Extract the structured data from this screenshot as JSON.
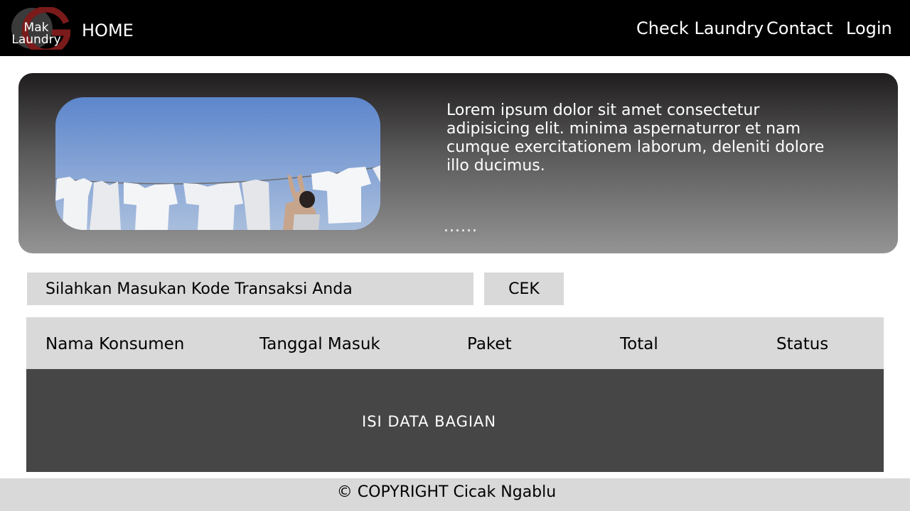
{
  "brand": {
    "logo_line1": "Mak",
    "logo_line2": "Laundry",
    "accent_color": "#7a1a1a"
  },
  "nav": {
    "home": "HOME",
    "links": [
      "Check Laundry",
      "Contact",
      "Login"
    ]
  },
  "hero": {
    "image": "laundry-clothesline-photo",
    "text": "Lorem ipsum dolor sit amet consectetur adipisicing elit.  minima aspernaturror et nam cumque exercitationem laborum, deleniti dolore illo ducimus.",
    "more": "......"
  },
  "search": {
    "placeholder": "Silahkan Masukan Kode Transaksi Anda",
    "button": "CEK"
  },
  "table": {
    "headers": [
      "Nama Konsumen",
      "Tanggal Masuk",
      "Paket",
      "Total",
      "Status"
    ],
    "body_text": "ISI DATA BAGIAN"
  },
  "footer": {
    "copyright": "© COPYRIGHT Cicak Ngablu"
  }
}
